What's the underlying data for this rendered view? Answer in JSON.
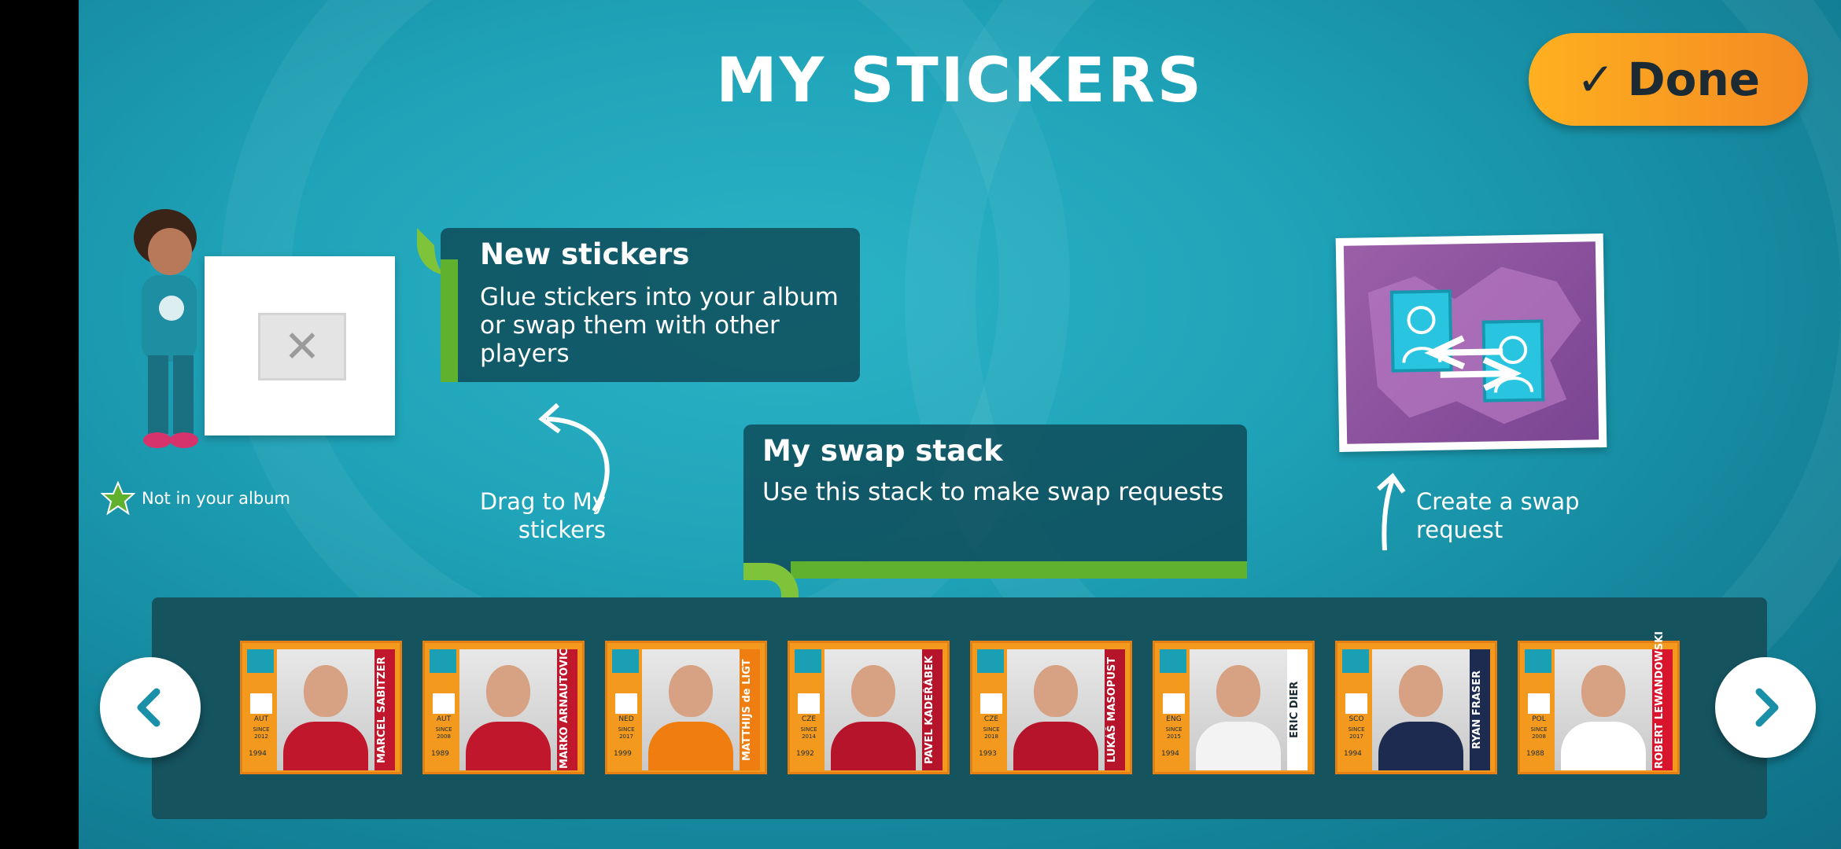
{
  "header": {
    "title": "MY STICKERS"
  },
  "done_button": {
    "label": "Done",
    "icon": "check-icon"
  },
  "new_stickers_panel": {
    "title": "New stickers",
    "body": "Glue stickers into your album or swap them with other players",
    "status_label": "Not in your album"
  },
  "drag_hint": "Drag to My stickers",
  "swap_stack_panel": {
    "title": "My swap stack",
    "body": "Use this stack to make swap requests"
  },
  "create_swap_hint": "Create a swap request",
  "colors": {
    "accent_orange": "#f39a1e",
    "done_start": "#ffb020",
    "done_end": "#f38a22",
    "panel": "#0d4855",
    "green": "#5fb12e",
    "tray": "#15535f"
  },
  "tray": {
    "prev_icon": "chevron-left-icon",
    "next_icon": "chevron-right-icon",
    "stickers": [
      {
        "name": "MARCEL SABITZER",
        "code": "AUT",
        "since": "SINCE 2012",
        "born": "1994",
        "shirt": "#c0172c",
        "bar": "#c0172c"
      },
      {
        "name": "MARKO ARNAUTOVIC",
        "code": "AUT",
        "since": "SINCE 2008",
        "born": "1989",
        "shirt": "#c0172c",
        "bar": "#c0172c"
      },
      {
        "name": "MATTHIJS de LIGT",
        "code": "NED",
        "since": "SINCE 2017",
        "born": "1999",
        "shirt": "#f07d10",
        "bar": "#f07d10"
      },
      {
        "name": "PAVEL KADEŘÁBEK",
        "code": "CZE",
        "since": "SINCE 2014",
        "born": "1992",
        "shirt": "#b5142a",
        "bar": "#b5142a"
      },
      {
        "name": "LUKÁŠ MASOPUST",
        "code": "CZE",
        "since": "SINCE 2018",
        "born": "1993",
        "shirt": "#b5142a",
        "bar": "#b5142a"
      },
      {
        "name": "ERIC DIER",
        "code": "ENG",
        "since": "SINCE 2015",
        "born": "1994",
        "shirt": "#f3f3f3",
        "bar": "#ffffff"
      },
      {
        "name": "RYAN FRASER",
        "code": "SCO",
        "since": "SINCE 2017",
        "born": "1994",
        "shirt": "#1c2b4f",
        "bar": "#1c2b4f"
      },
      {
        "name": "ROBERT LEWANDOWSKI",
        "code": "POL",
        "since": "SINCE 2008",
        "born": "1988",
        "shirt": "#ffffff",
        "bar": "#d8152c"
      }
    ]
  }
}
